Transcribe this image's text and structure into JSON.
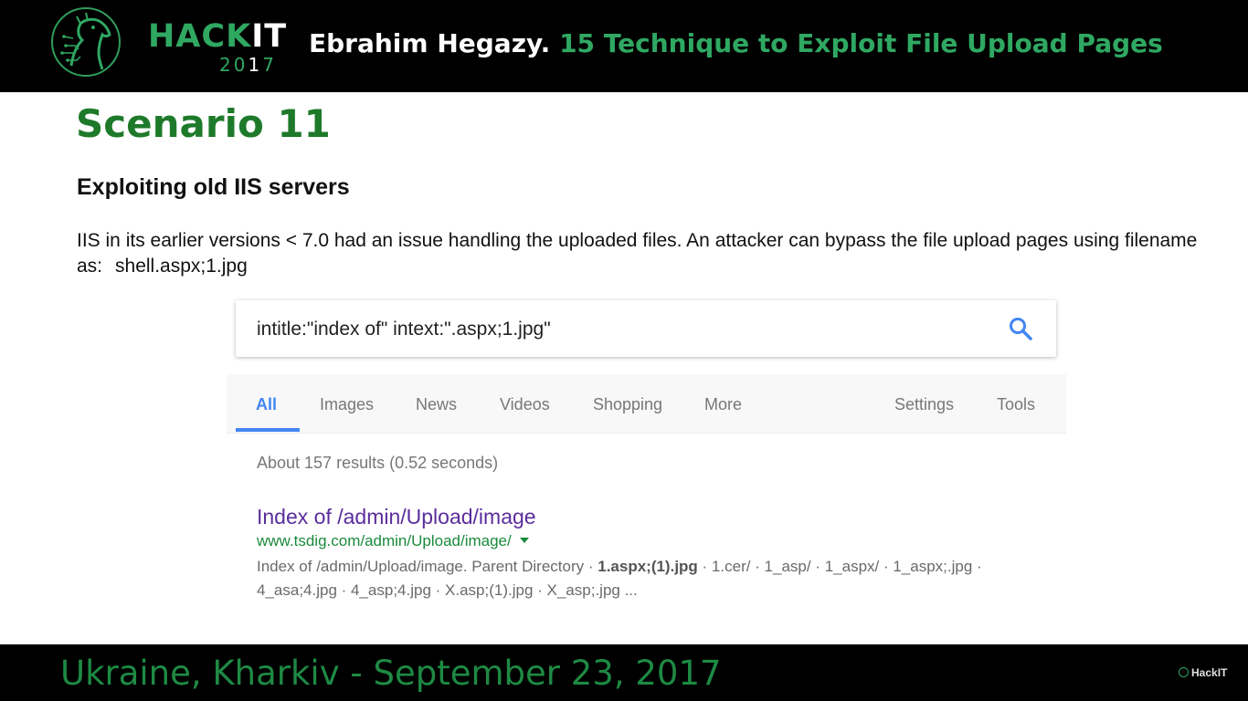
{
  "banner": {
    "brand_hack_1": "HACK",
    "brand_hack_2": "IT",
    "brand_year_1": "20",
    "brand_year_2": "1",
    "brand_year_3": "7",
    "speaker": "Ebrahim Hegazy.",
    "talk_title": "15 Technique to Exploit File Upload Pages"
  },
  "slide": {
    "heading": "Scenario 11",
    "subtitle": "Exploiting old IIS servers",
    "description": "IIS in its earlier versions < 7.0 had an issue handling the uploaded files. An attacker can bypass the file upload pages using filename as:",
    "filename": "shell.aspx;1.jpg"
  },
  "search": {
    "query": "intitle:\"index of\" intext:\".aspx;1.jpg\"",
    "icons": {
      "search": "search-icon",
      "url_menu": "dropdown-caret-icon"
    },
    "tabs": [
      "All",
      "Images",
      "News",
      "Videos",
      "Shopping",
      "More"
    ],
    "tools": [
      "Settings",
      "Tools"
    ],
    "active_tab": "All",
    "stats": "About 157 results (0.52 seconds)",
    "result": {
      "title": "Index of /admin/Upload/image",
      "url": "www.tsdig.com/admin/Upload/image/",
      "snippet_1": "Index of /admin/Upload/image. Parent Directory · ",
      "snippet_bold": "1.aspx;(1).jpg",
      "snippet_2": " · 1.cer/ · 1_asp/ · 1_aspx/ · 1_aspx;.jpg · 4_asa;4.jpg · 4_asp;4.jpg · X.asp;(1).jpg · X_asp;.jpg ..."
    }
  },
  "footer": {
    "location": "Ukraine, Kharkiv - September 23, 2017",
    "brand": "HackIT"
  },
  "colors": {
    "accent_green": "#2fa862",
    "heading_green": "#1e7a2a",
    "link_purple": "#5a2d9c",
    "url_green": "#1a8a3c",
    "google_blue": "#4285f4"
  }
}
